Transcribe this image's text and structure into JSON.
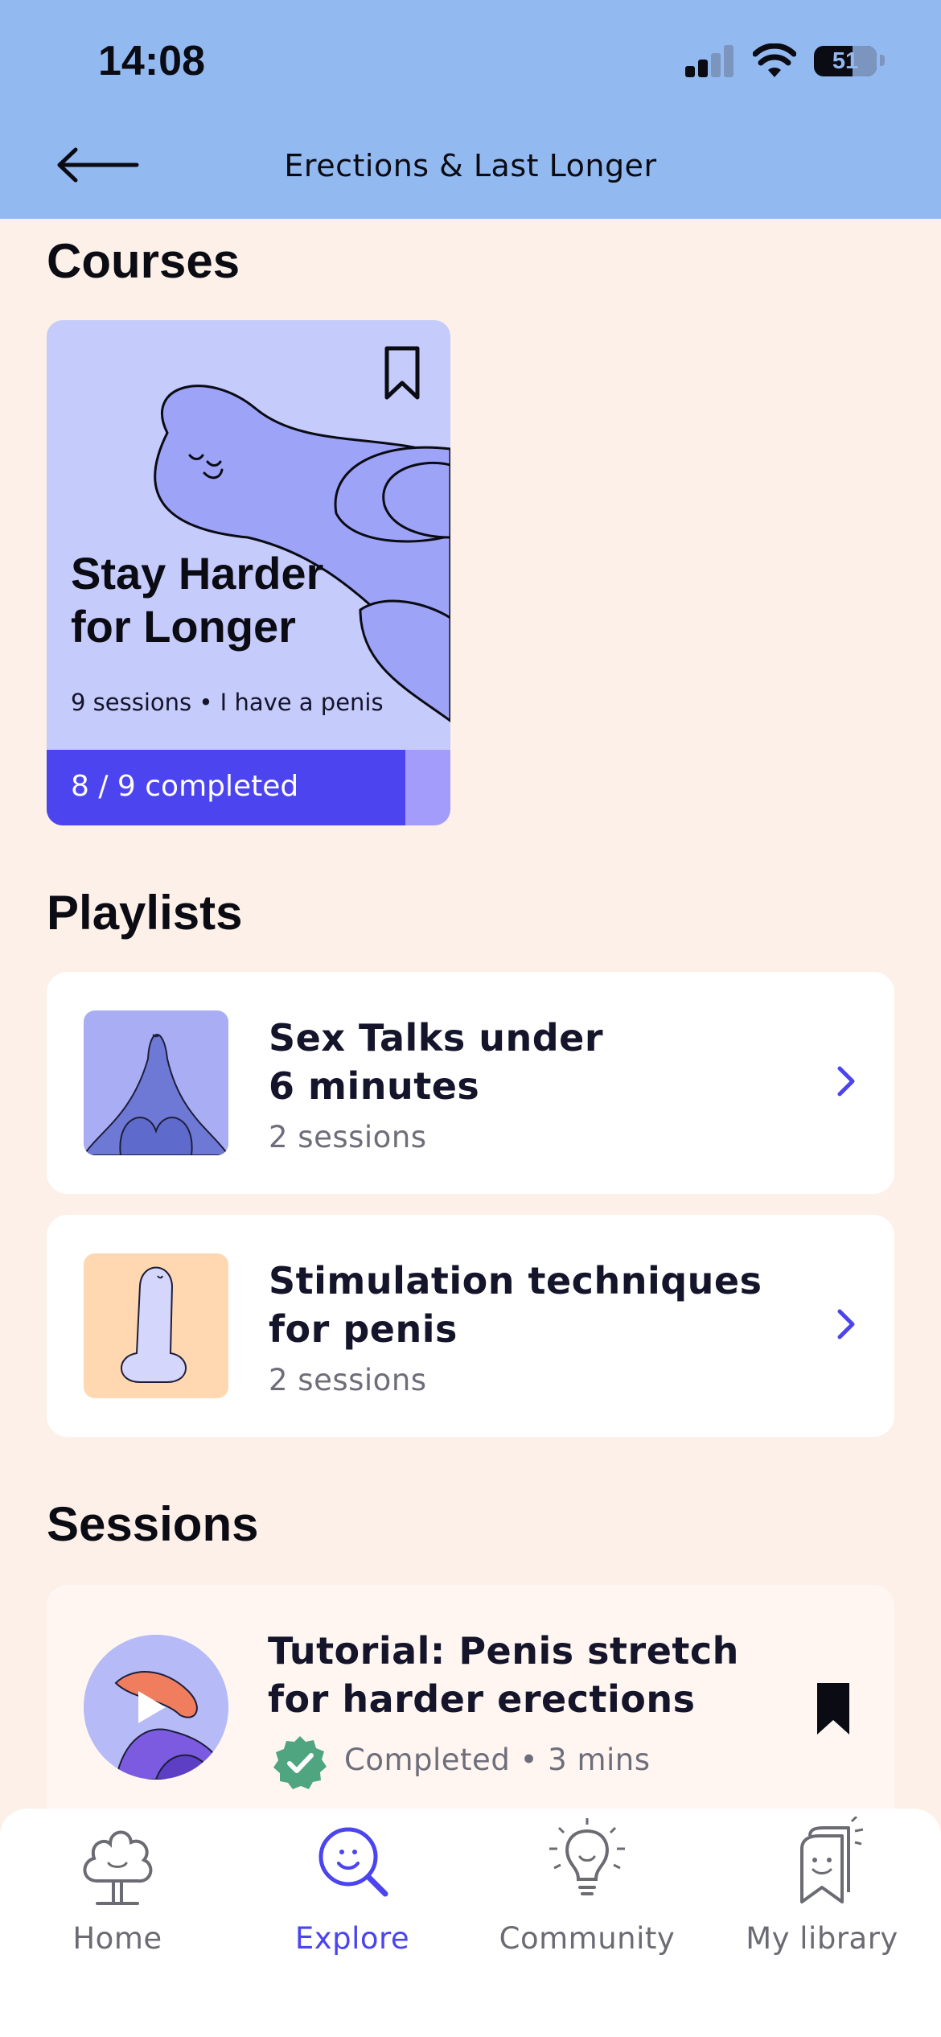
{
  "status_bar": {
    "time": "14:08",
    "battery": "51"
  },
  "header": {
    "title": "Erections & Last Longer"
  },
  "sections": {
    "courses": "Courses",
    "playlists": "Playlists",
    "sessions": "Sessions"
  },
  "course": {
    "title_line1": "Stay Harder",
    "title_line2": "for Longer",
    "meta": "9 sessions • I have a penis",
    "progress_label": "8 / 9 completed",
    "progress_fraction": 0.889,
    "bookmarked": false
  },
  "playlists": [
    {
      "title_line1": "Sex Talks under",
      "title_line2": "6 minutes",
      "sessions": "2 sessions",
      "icon": "sex-talks-thumbnail"
    },
    {
      "title_line1": "Stimulation techniques",
      "title_line2": "for penis",
      "sessions": "2 sessions",
      "icon": "stimulation-thumbnail"
    }
  ],
  "session": {
    "title_line1": "Tutorial: Penis stretch",
    "title_line2": "for harder erections",
    "meta": "Completed • 3 mins",
    "bookmarked": true
  },
  "nav": [
    {
      "label": "Home",
      "icon": "home-tree-icon",
      "active": false
    },
    {
      "label": "Explore",
      "icon": "explore-search-icon",
      "active": true
    },
    {
      "label": "Community",
      "icon": "community-bulb-icon",
      "active": false
    },
    {
      "label": "My library",
      "icon": "library-icon",
      "active": false
    }
  ],
  "colors": {
    "header_bg": "#93BAF0",
    "page_bg": "#FCF0E8",
    "accent": "#4B44EF",
    "course_card_bg": "#C5CBFA",
    "completed_green": "#4FA57F"
  }
}
